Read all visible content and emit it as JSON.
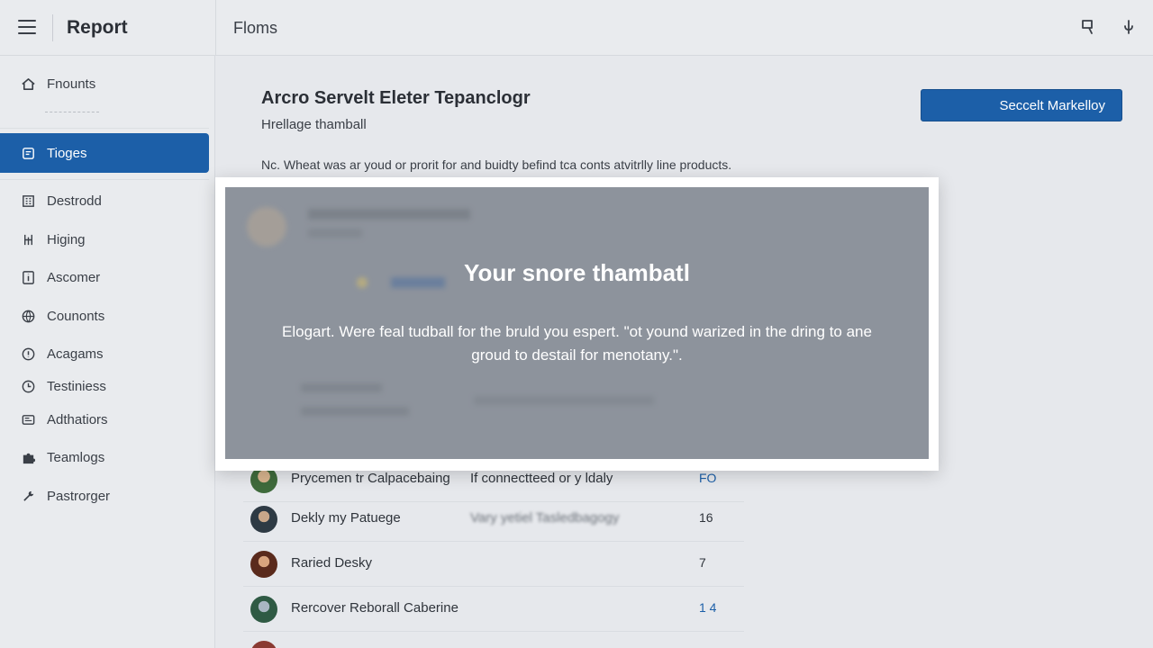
{
  "header": {
    "brand": "Report",
    "page_heading": "Floms",
    "icons": [
      "menu-icon",
      "search-icon",
      "microphone-icon"
    ]
  },
  "sidebar": {
    "items": [
      {
        "label": "Fnounts",
        "icon": "home-icon",
        "active": false
      },
      {
        "label": "Tioges",
        "icon": "tag-icon",
        "active": true
      },
      {
        "label": "Destrodd",
        "icon": "building-icon",
        "active": false
      },
      {
        "label": "Higing",
        "icon": "hierarchy-icon",
        "active": false
      },
      {
        "label": "Ascomer",
        "icon": "info-icon",
        "active": false
      },
      {
        "label": "Counonts",
        "icon": "globe-icon",
        "active": false
      },
      {
        "label": "Acagams",
        "icon": "alert-icon",
        "active": false
      },
      {
        "label": "Testiniess",
        "icon": "clock-icon",
        "active": false
      },
      {
        "label": "Adthatiors",
        "icon": "layers-icon",
        "active": false
      },
      {
        "label": "Teamlogs",
        "icon": "puzzle-icon",
        "active": false
      },
      {
        "label": "Pastrorger",
        "icon": "wrench-icon",
        "active": false
      }
    ]
  },
  "main": {
    "title": "Arcro Servelt Eleter Tepanclogr",
    "subtitle": "Hrellage thamball",
    "description": "Nc. Wheat was ar youd or prorit for and buidty befind tca conts atvitrlly line products.",
    "primary_button": "Seccelt Markelloy"
  },
  "list": {
    "rows": [
      {
        "name": "Prycemen tr Calpacebaing",
        "status": "If connectteed or y ldaly",
        "count": "FO",
        "count_blue": true,
        "status_blurred": false
      },
      {
        "name": "Dekly my Patuege",
        "status": "Vary yetiel Tasledbagogy",
        "count": "16",
        "count_blue": false,
        "status_blurred": true
      },
      {
        "name": "Raried Desky",
        "status": "",
        "count": "7",
        "count_blue": false,
        "status_blurred": false
      },
      {
        "name": "Rercover Reborall Caberine",
        "status": "",
        "count": "1 4",
        "count_blue": true,
        "status_blurred": false
      }
    ]
  },
  "modal": {
    "title": "Your snore thambatl",
    "body": "Elogart. Were feal tudball for the bruld you espert. \"ot yound warized in the dring to ane groud to destail for menotany.\"."
  },
  "colors": {
    "accent": "#1c5fa8",
    "modal_overlay": "#8d939c",
    "background": "#e6e8ec"
  }
}
